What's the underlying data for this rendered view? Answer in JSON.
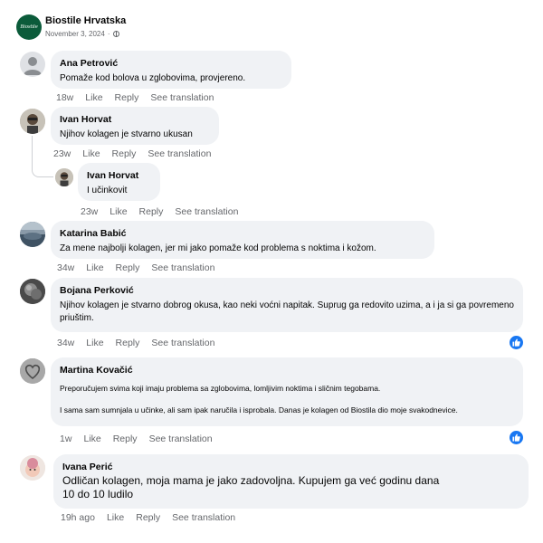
{
  "post": {
    "page_name": "Biostile Hrvatska",
    "logo_text": "Biostile",
    "date": "November 3, 2024",
    "separator": "·",
    "privacy_icon": "globe-icon"
  },
  "action_labels": {
    "like": "Like",
    "reply": "Reply",
    "translate": "See translation"
  },
  "comments": [
    {
      "author": "Ana Petrović",
      "text": "Pomaže kod bolova u zglobovima, provjereno.",
      "age": "18w",
      "avatar": "default-avatar-icon"
    },
    {
      "author": "Ivan Horvat",
      "text": "Njihov kolagen je stvarno ukusan",
      "age": "23w",
      "avatar": "profile-photo"
    },
    {
      "author": "Ivan Horvat",
      "text": "I učinkovit",
      "age": "23w",
      "avatar": "profile-photo",
      "is_reply": true
    },
    {
      "author": "Katarina Babić",
      "text": "Za mene najbolji kolagen, jer mi jako pomaže kod problema s noktima i kožom.",
      "age": "34w",
      "avatar": "profile-photo"
    },
    {
      "author": "Bojana Perković",
      "text": "Njihov kolagen je stvarno dobrog okusa, kao neki voćni napitak. Suprug ga redovito uzima, a i ja si ga povremeno priuštim.",
      "age": "34w",
      "avatar": "profile-photo",
      "reaction": "like-icon"
    },
    {
      "author": "Martina Kovačić",
      "text": "Preporučujem svima koji imaju problema sa zglobovima, lomljivim noktima i sličnim tegobama.\n\nI sama sam sumnjala u učinke, ali sam ipak naručila i isprobala. Danas je kolagen od Biostila dio moje svakodnevice.",
      "age": "1w",
      "avatar": "profile-photo",
      "reaction": "like-icon"
    },
    {
      "author": "Ivana Perić",
      "text": "Odličan kolagen, moja mama je jako zadovoljna. Kupujem ga već godinu dana\n10 do 10 ludilo",
      "age": "19h ago",
      "avatar": "profile-photo"
    }
  ],
  "colors": {
    "bubble": "#f0f2f5",
    "meta_text": "#65676b",
    "like_blue": "#1877f2",
    "logo_green": "#0b5b3a"
  }
}
